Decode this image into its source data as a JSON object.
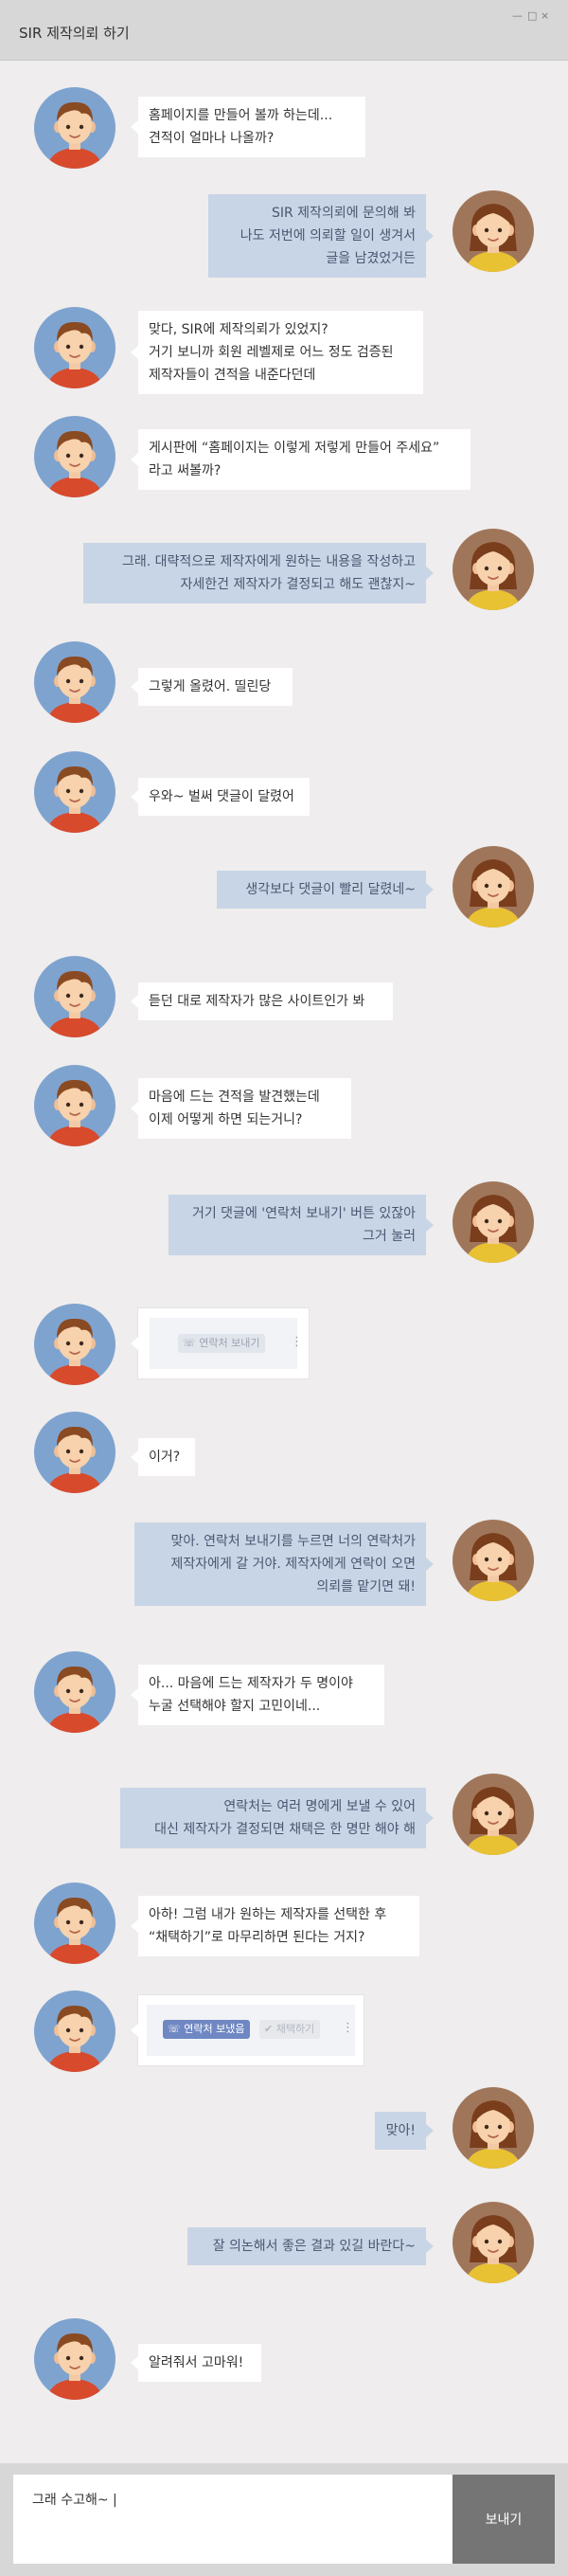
{
  "window": {
    "title": "SIR 제작의뢰 하기",
    "controls": [
      "—",
      "□",
      "×"
    ]
  },
  "messages": [
    {
      "side": "left",
      "text": "홈페이지를 만들어 볼까 하는데...\n견적이 얼마나 나올까?"
    },
    {
      "side": "right",
      "text": "SIR 제작의뢰에 문의해 봐\n나도 저번에 의뢰할 일이 생겨서\n글을 남겼었거든"
    },
    {
      "side": "left",
      "text": "맞다, SIR에 제작의뢰가 있었지?\n거기 보니까 회원 레벨제로 어느 정도 검증된\n제작자들이 견적을 내준다던데"
    },
    {
      "side": "left",
      "text": "게시판에 “홈페이지는 이렇게 저렇게 만들어 주세요”\n라고 써볼까?"
    },
    {
      "side": "right",
      "text": "그래. 대략적으로 제작자에게 원하는 내용을 작성하고\n자세한건 제작자가 결정되고 해도 괜찮지~"
    },
    {
      "side": "left",
      "text": "그렇게 올렸어. 띨린당"
    },
    {
      "side": "left",
      "text": "우와~ 벌써 댓글이 달렸어"
    },
    {
      "side": "right",
      "text": "생각보다 댓글이 빨리 달렸네~"
    },
    {
      "side": "left",
      "text": "듣던 대로 제작자가 많은 사이트인가 봐"
    },
    {
      "side": "left",
      "text": "마음에 드는 견적을 발견했는데\n이제 어떻게 하면 되는거니?"
    },
    {
      "side": "right",
      "text": "거기 댓글에 '연락처 보내기' 버튼 있잖아\n그거 눌러"
    },
    {
      "side": "left",
      "type": "card1"
    },
    {
      "side": "left",
      "text": "이거?"
    },
    {
      "side": "right",
      "text": "맞아. 연락처 보내기를 누르면 너의 연락처가\n제작자에게 갈 거야. 제작자에게 연락이 오면\n의뢰를 맡기면 돼!"
    },
    {
      "side": "left",
      "text": "아... 마음에 드는 제작자가 두 명이야\n누굴 선택해야 할지 고민이네..."
    },
    {
      "side": "right",
      "text": "연락처는 여러 명에게 보낼 수 있어\n대신 제작자가 결정되면 채택은 한 명만 해야 해"
    },
    {
      "side": "left",
      "text": "아하! 그럼 내가 원하는 제작자를 선택한 후\n“채택하기”로 마무리하면 된다는 거지?"
    },
    {
      "side": "left",
      "type": "card2"
    },
    {
      "side": "right",
      "text": "맞아!"
    },
    {
      "side": "right",
      "text": "잘 의논해서 좋은 결과 있길 바란다~"
    },
    {
      "side": "left",
      "text": "알려줘서 고마워!"
    }
  ],
  "cards": {
    "send_contact": "연락처 보내기",
    "contact_sent": "연락처 보냈음",
    "adopt": "채택하기",
    "more_glyph": "⋮",
    "phone_glyph": "☏",
    "check_glyph": "✔"
  },
  "composer": {
    "value": "그래 수고해~ |",
    "send_label": "보내기"
  },
  "colors": {
    "titlebar": "#d7d7d7",
    "background": "#efeded",
    "right_bubble": "#c8d5e6",
    "left_bubble": "#ffffff",
    "send_button": "#757575",
    "active_button": "#6f87c2"
  }
}
